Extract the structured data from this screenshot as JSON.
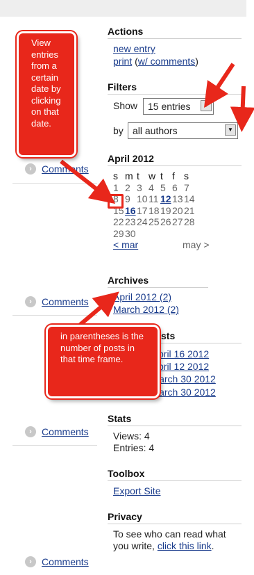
{
  "sidebar": {
    "comments_label": "Comments",
    "actions": {
      "heading": "Actions",
      "new_entry": "new entry",
      "print": "print",
      "print_with_comments": "w/ comments"
    },
    "filters": {
      "heading": "Filters",
      "show_label": "Show",
      "show_value": "15 entries",
      "by_label": "by",
      "by_value": "all authors"
    },
    "calendar": {
      "heading": "April 2012",
      "weekdays": [
        "s",
        "m",
        "t",
        "w",
        "t",
        "f",
        "s"
      ],
      "weeks": [
        [
          "1",
          "2",
          "3",
          "4",
          "5",
          "6",
          "7"
        ],
        [
          "8",
          "9",
          "10",
          "11",
          "12",
          "13",
          "14"
        ],
        [
          "15",
          "16",
          "17",
          "18",
          "19",
          "20",
          "21"
        ],
        [
          "22",
          "23",
          "24",
          "25",
          "26",
          "27",
          "28"
        ],
        [
          "29",
          "30",
          "",
          "",
          "",
          "",
          ""
        ]
      ],
      "linked_days": [
        "12",
        "16"
      ],
      "prev_link": "< mar",
      "next_text": "may >"
    },
    "archives": {
      "heading": "Archives",
      "items": [
        "April 2012 (2)",
        "March 2012 (2)"
      ]
    },
    "recent_posts": {
      "heading_visible": "sts",
      "items": [
        "pril 16 2012",
        "pril 12 2012",
        "larch 30 2012",
        "larch 30 2012"
      ]
    },
    "stats": {
      "heading": "Stats",
      "views": "Views: 4",
      "entries": "Entries: 4"
    },
    "toolbox": {
      "heading": "Toolbox",
      "export": "Export Site"
    },
    "privacy": {
      "heading": "Privacy",
      "text_line1": "To see who can read what",
      "text_line2": "you write,",
      "link": "click this link",
      "period": "."
    }
  },
  "annotations": {
    "note1": "View entries from a certain date by clicking on that date.",
    "note2": "in parentheses is the number of posts in that time frame.",
    "accent": "#e8271b"
  }
}
